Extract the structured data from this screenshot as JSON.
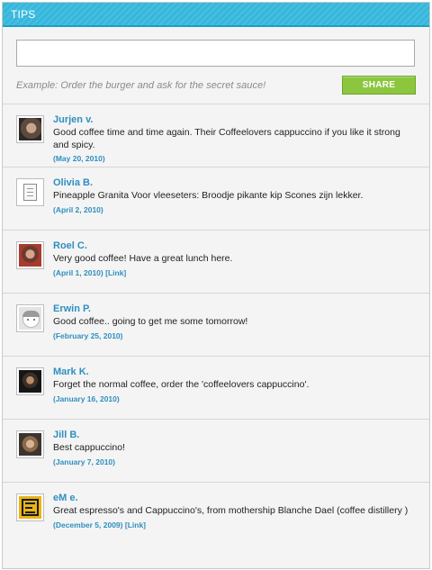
{
  "panel": {
    "title": "TIPS"
  },
  "form": {
    "input_value": "",
    "input_placeholder": "",
    "example_text": "Example: Order the burger and ask for the secret sauce!",
    "share_label": "SHARE",
    "share_color": "#8cc63f"
  },
  "colors": {
    "header": "#35b7dc",
    "link": "#2f8fc0"
  },
  "tips": [
    {
      "name": "Jurjen v.",
      "text": "Good coffee time and time again. Their Coffeelovers cappuccino if you like it strong and spicy.",
      "date": "(May 20, 2010)",
      "link": "",
      "avatar_icon": "user-photo-icon"
    },
    {
      "name": "Olivia B.",
      "text": "Pineapple Granita Voor vleeseters: Broodje pikante kip Scones zijn lekker.",
      "date": "(April 2, 2010)",
      "link": "",
      "avatar_icon": "document-icon"
    },
    {
      "name": "Roel C.",
      "text": "Very good coffee! Have a great lunch here.",
      "date": "(April 1, 2010)",
      "link": "[Link]",
      "avatar_icon": "user-photo-icon"
    },
    {
      "name": "Erwin P.",
      "text": "Good coffee.. going to get me some tomorrow!",
      "date": "(February 25, 2010)",
      "link": "",
      "avatar_icon": "default-avatar-icon"
    },
    {
      "name": "Mark K.",
      "text": "Forget the normal coffee, order the 'coffeelovers cappuccino'.",
      "date": "(January 16, 2010)",
      "link": "",
      "avatar_icon": "user-photo-icon"
    },
    {
      "name": "Jill B.",
      "text": "Best cappuccino!",
      "date": "(January 7, 2010)",
      "link": "",
      "avatar_icon": "user-photo-icon"
    },
    {
      "name": "eM e.",
      "text": "Great espresso's and Cappuccino's, from mothership Blanche Dael (coffee distillery )",
      "date": "(December 5, 2009)",
      "link": "[Link]",
      "avatar_icon": "logo-icon"
    }
  ]
}
